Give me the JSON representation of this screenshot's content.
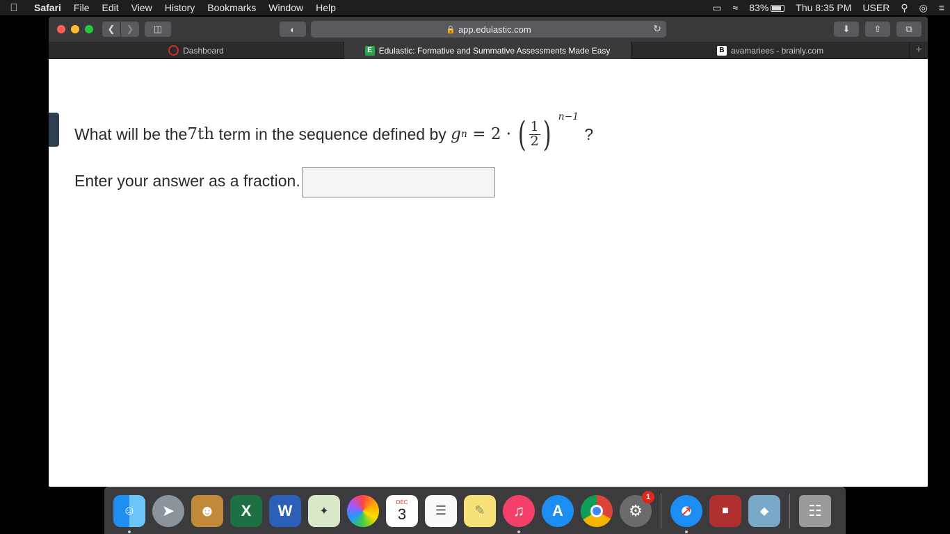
{
  "menubar": {
    "app": "Safari",
    "items": [
      "File",
      "Edit",
      "View",
      "History",
      "Bookmarks",
      "Window",
      "Help"
    ],
    "battery": "83%",
    "clock": "Thu 8:35 PM",
    "user": "USER"
  },
  "browser": {
    "url": "app.edulastic.com",
    "tabs": [
      {
        "label": "Dashboard",
        "active": false
      },
      {
        "label": "Edulastic: Formative and Summative Assessments Made Easy",
        "active": true
      },
      {
        "label": "avamariees - brainly.com",
        "active": false
      }
    ]
  },
  "question": {
    "text_before": "What will be the ",
    "ordinal": "7th",
    "text_after": " term in the sequence defined by ",
    "var": "g",
    "subscript": "n",
    "equals_part": " = 2 ·",
    "frac_num": "1",
    "frac_den": "2",
    "exponent": "n−1",
    "qmark": "?"
  },
  "answer": {
    "prompt": "Enter your answer as a fraction.",
    "value": ""
  },
  "dock": {
    "calendar_month": "DEC",
    "calendar_day": "3",
    "settings_badge": "1",
    "excel_letter": "X",
    "word_letter": "W"
  }
}
